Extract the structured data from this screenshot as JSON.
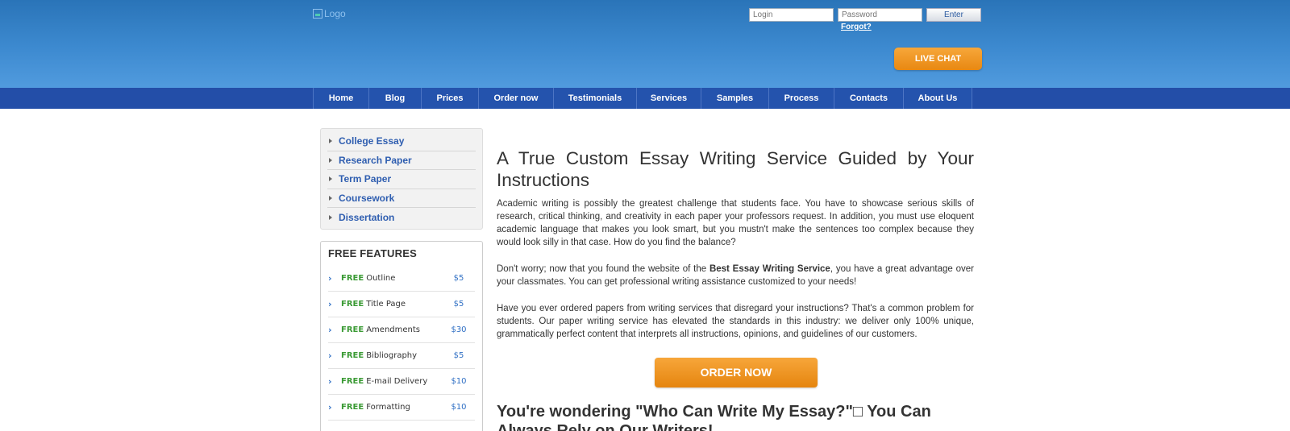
{
  "header": {
    "logo_alt": "Logo",
    "login_placeholder": "Login",
    "password_placeholder": "Password",
    "enter_label": "Enter",
    "forgot_label": "Forgot?",
    "live_chat_label": "LIVE CHAT"
  },
  "nav": {
    "items": [
      {
        "label": "Home"
      },
      {
        "label": "Blog"
      },
      {
        "label": "Prices"
      },
      {
        "label": "Order now"
      },
      {
        "label": "Testimonials"
      },
      {
        "label": "Services"
      },
      {
        "label": "Samples"
      },
      {
        "label": "Process"
      },
      {
        "label": "Contacts"
      },
      {
        "label": "About Us"
      }
    ]
  },
  "sidebar": {
    "categories": [
      {
        "label": "College Essay"
      },
      {
        "label": "Research Paper"
      },
      {
        "label": "Term Paper"
      },
      {
        "label": "Coursework"
      },
      {
        "label": "Dissertation"
      }
    ],
    "features_title": "FREE FEATURES",
    "features": [
      {
        "free": "FREE",
        "name": "Outline",
        "price": "$5"
      },
      {
        "free": "FREE",
        "name": "Title Page",
        "price": "$5"
      },
      {
        "free": "FREE",
        "name": "Amendments",
        "price": "$30"
      },
      {
        "free": "FREE",
        "name": "Bibliography",
        "price": "$5"
      },
      {
        "free": "FREE",
        "name": "E-mail Delivery",
        "price": "$10"
      },
      {
        "free": "FREE",
        "name": "Formatting",
        "price": "$10"
      }
    ]
  },
  "main": {
    "heading": "A True Custom Essay Writing Service Guided by Your Instructions",
    "p1": "Academic writing is possibly the greatest challenge that students face. You have to showcase serious skills of research, critical thinking, and creativity in each paper your professors request. In addition, you must use eloquent academic language that makes you look smart, but you mustn't make the sentences too complex because they would look silly in that case. How do you find the balance?",
    "p2_before": "Don't worry; now that you found the website of the ",
    "p2_bold": "Best Essay Writing Service",
    "p2_after": ", you have a great advantage over your classmates. You can get professional writing assistance customized to your needs!",
    "p3": "Have you ever ordered papers from writing services that disregard your instructions? That's a common problem for students. Our paper writing service has elevated the standards in this industry: we deliver only 100% unique, grammatically perfect content that interprets all instructions, opinions, and guidelines of our customers.",
    "order_label": "ORDER NOW",
    "sub_heading": "You're wondering \"Who Can Write My Essay?\"□ You Can Always Rely on Our Writers!"
  }
}
